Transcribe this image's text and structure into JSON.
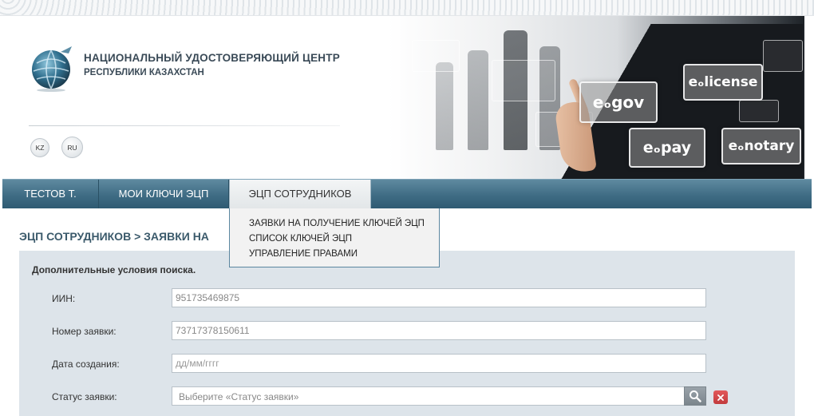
{
  "header": {
    "org_name": "НАЦИОНАЛЬНЫЙ УДОСТОВЕРЯЮЩИЙ ЦЕНТР",
    "org_subtitle": "РЕСПУБЛИКИ КАЗАХСТАН",
    "lang_kz": "KZ",
    "lang_ru": "RU"
  },
  "banner": {
    "screens": [
      "eₒgov",
      "eₒlicense",
      "eₒpay",
      "eₒnotary"
    ]
  },
  "nav": {
    "user": "ТЕСТОВ Т.",
    "my_keys": "МОИ КЛЮЧИ ЭЦП",
    "staff_keys": "ЭЦП СОТРУДНИКОВ"
  },
  "dropdown": {
    "items": [
      "ЗАЯВКИ НА ПОЛУЧЕНИЕ КЛЮЧЕЙ ЭЦП",
      "СПИСОК КЛЮЧЕЙ ЭЦП",
      "УПРАВЛЕНИЕ ПРАВАМИ"
    ]
  },
  "page": {
    "title": "ЭЦП СОТРУДНИКОВ > ЗАЯВКИ НА"
  },
  "search": {
    "panel_title": "Дополнительные условия поиска.",
    "iin_label": "ИИН:",
    "iin_value": "951735469875",
    "request_no_label": "Номер заявки:",
    "request_no_value": "73717378150611",
    "created_label": "Дата создания:",
    "created_placeholder": "дд/мм/гггг",
    "status_label": "Статус заявки:",
    "status_placeholder": "Выберите «Статус заявки»"
  },
  "colors": {
    "nav_bg": "#3f6c84",
    "panel_bg": "#dde4ea",
    "title_text": "#3b5a6b",
    "clear_button": "#c23b3d"
  },
  "icons": [
    "globe-logo-icon",
    "search-icon",
    "close-icon"
  ]
}
